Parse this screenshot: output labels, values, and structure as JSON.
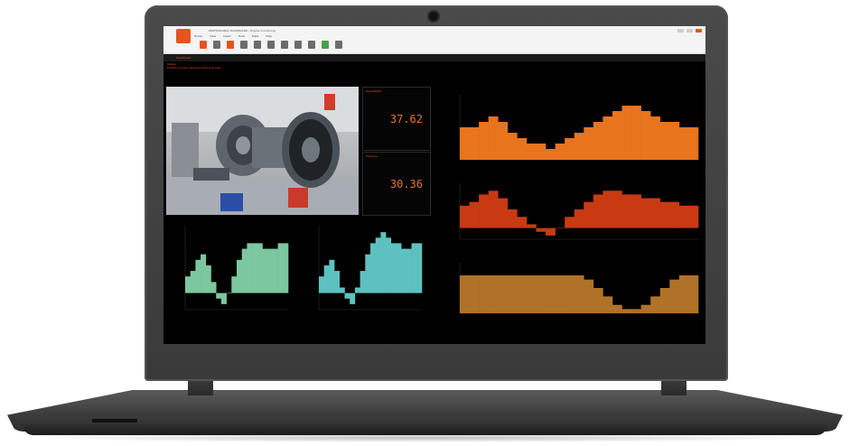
{
  "app": {
    "title": "PROFESSIONAL DASHBOARD - Engine monitoring",
    "tabs": [
      "Home",
      "View",
      "Insert",
      "Tools",
      "Data",
      "Help"
    ]
  },
  "toolbar": {
    "tool_icons": [
      "save-icon",
      "open-icon",
      "chart-icon",
      "table-icon",
      "gauge-icon",
      "image-icon",
      "panel-icon",
      "layout-icon",
      "grid-icon",
      "play-icon",
      "export-icon"
    ]
  },
  "breadcrumb": "Dashboard",
  "dashboard": {
    "header_line1": "Status",
    "header_line2": "Engine process measurement Overview"
  },
  "panels": [
    {
      "label": "Speed/RPM",
      "value": "37.62"
    },
    {
      "label": "Pressure",
      "value": "30.36"
    }
  ],
  "colors": {
    "accent": "#e8541e",
    "series_orange": "#e8741e",
    "series_red": "#c93a12",
    "series_brown": "#b07228",
    "series_green": "#7cc7a0",
    "series_teal": "#5ec1c1"
  },
  "chart_data": [
    {
      "type": "area",
      "series": [
        {
          "values": [
            6,
            6,
            7,
            8,
            7,
            5,
            4,
            3,
            3,
            2,
            3,
            4,
            5,
            6,
            7,
            8,
            9,
            10,
            10,
            9,
            8,
            7,
            7,
            6,
            6
          ]
        }
      ],
      "ylim": [
        0,
        12
      ]
    },
    {
      "type": "area",
      "series": [
        {
          "values": [
            6,
            7,
            9,
            10,
            8,
            5,
            3,
            1,
            -1,
            -2,
            0,
            3,
            5,
            7,
            9,
            10,
            10,
            9,
            9,
            8,
            8,
            7,
            7,
            6,
            6
          ]
        }
      ],
      "ylim": [
        -3,
        12
      ]
    },
    {
      "type": "area",
      "series": [
        {
          "values": [
            9,
            9,
            9,
            9,
            9,
            9,
            9,
            9,
            9,
            9,
            9,
            9,
            9,
            8,
            6,
            4,
            2,
            1,
            1,
            2,
            4,
            6,
            8,
            9,
            9
          ]
        }
      ],
      "ylim": [
        0,
        12
      ]
    },
    {
      "type": "area",
      "series": [
        {
          "values": [
            3,
            4,
            6,
            7,
            5,
            2,
            -1,
            -2,
            0,
            3,
            6,
            8,
            9,
            9,
            9,
            8,
            8,
            8,
            9,
            9
          ]
        }
      ],
      "ylim": [
        -3,
        12
      ]
    },
    {
      "type": "area",
      "series": [
        {
          "values": [
            3,
            5,
            6,
            4,
            1,
            -1,
            -2,
            1,
            4,
            7,
            9,
            10,
            11,
            10,
            9,
            9,
            8,
            8,
            9,
            9
          ]
        }
      ],
      "ylim": [
        -3,
        12
      ]
    }
  ]
}
